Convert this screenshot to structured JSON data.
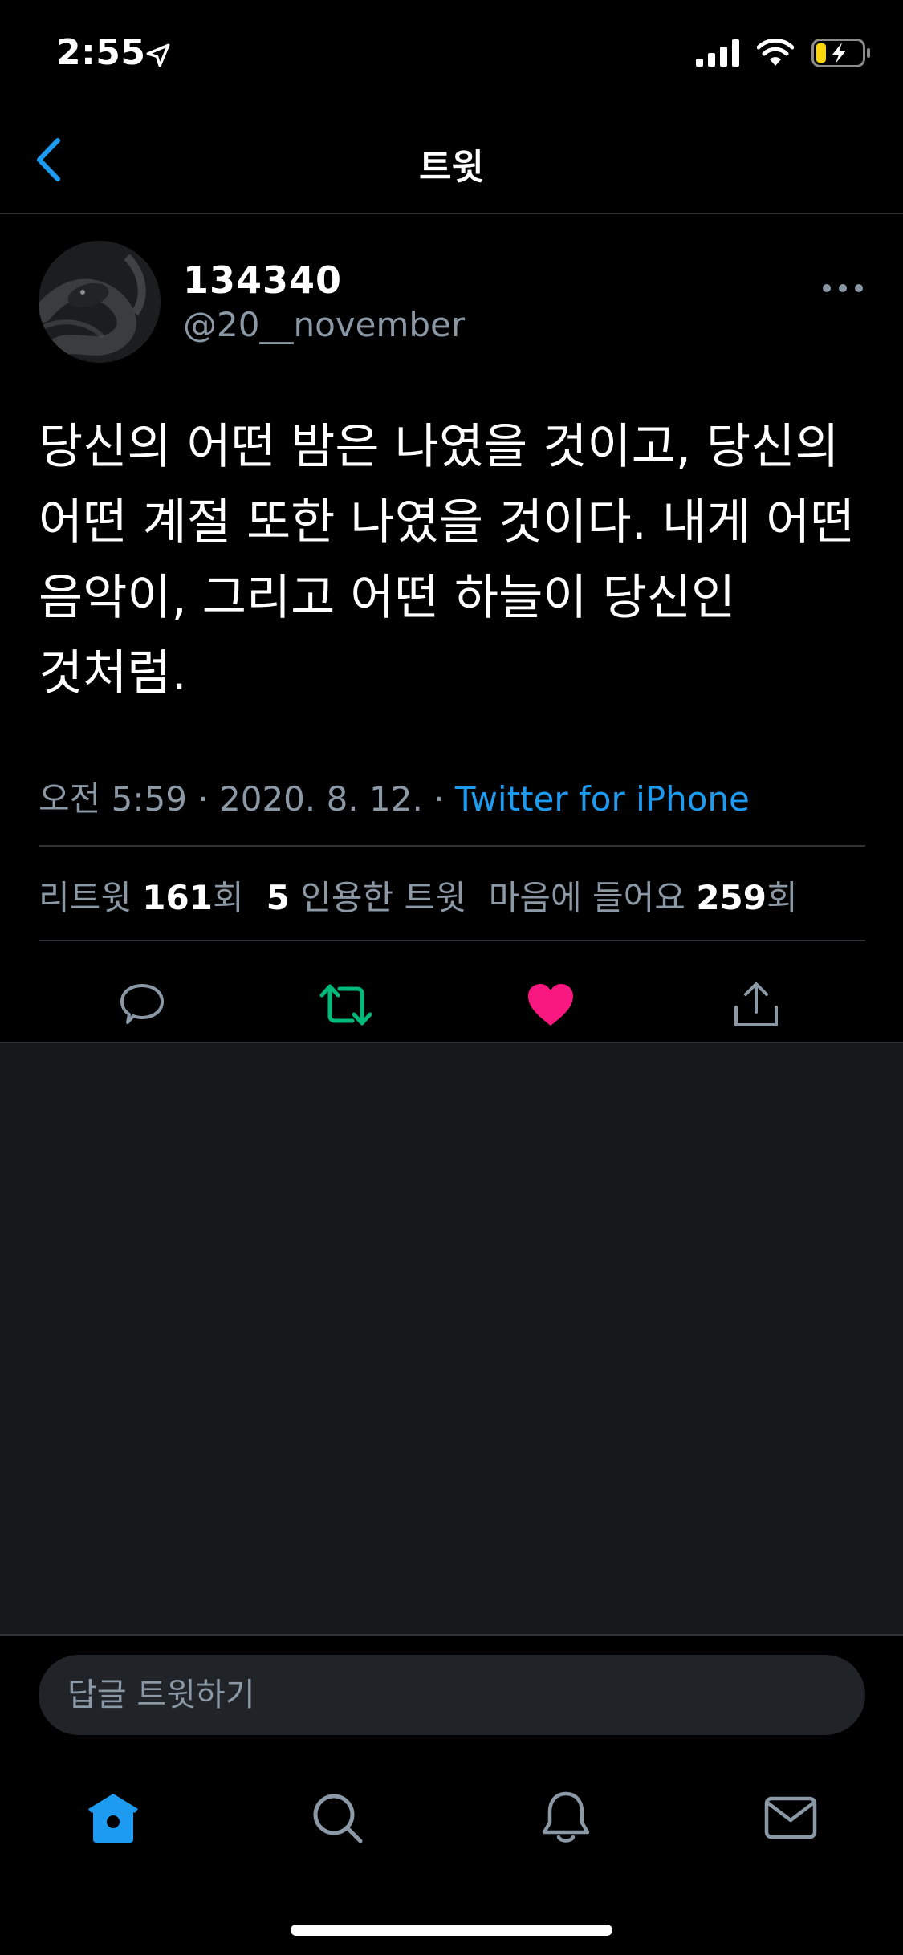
{
  "status_bar": {
    "time": "2:55",
    "icons": [
      "location-arrow-icon",
      "cellular-signal-icon",
      "wifi-icon",
      "battery-charging-icon"
    ]
  },
  "nav": {
    "back_icon": "chevron-left-icon",
    "title": "트윗"
  },
  "tweet": {
    "author": {
      "display_name": "134340",
      "handle": "@20__november"
    },
    "more_icon": "more-horizontal-icon",
    "text": "당신의 어떤 밤은 나였을 것이고, 당신의 어떤 계절 또한 나였을 것이다. 내게 어떤 음악이, 그리고 어떤 하늘이 당신인 것처럼.",
    "timestamp": "오전 5:59 · 2020. 8. 12. · ",
    "source": "Twitter for iPhone",
    "stats": {
      "retweets_label": "리트윗",
      "retweets_count": "161",
      "retweets_suffix": "회",
      "quotes_count": "5",
      "quotes_label": "인용한 트윗",
      "likes_label": "마음에 들어요",
      "likes_count": "259",
      "likes_suffix": "회"
    },
    "actions": {
      "reply_icon": "reply-bubble-icon",
      "retweet_icon": "retweet-icon",
      "like_icon": "heart-filled-icon",
      "share_icon": "share-icon"
    }
  },
  "reply": {
    "placeholder": "답글 트윗하기",
    "value": ""
  },
  "tab_bar": {
    "tabs": [
      "home-icon",
      "search-icon",
      "notifications-bell-icon",
      "messages-envelope-icon"
    ],
    "active": "home-icon"
  },
  "colors": {
    "accent": "#1d9bf0",
    "retweet_green": "#00ba7c",
    "like_pink": "#f91880",
    "secondary_text": "#8b98a5",
    "background": "#000000",
    "empty_area": "#17181c"
  }
}
